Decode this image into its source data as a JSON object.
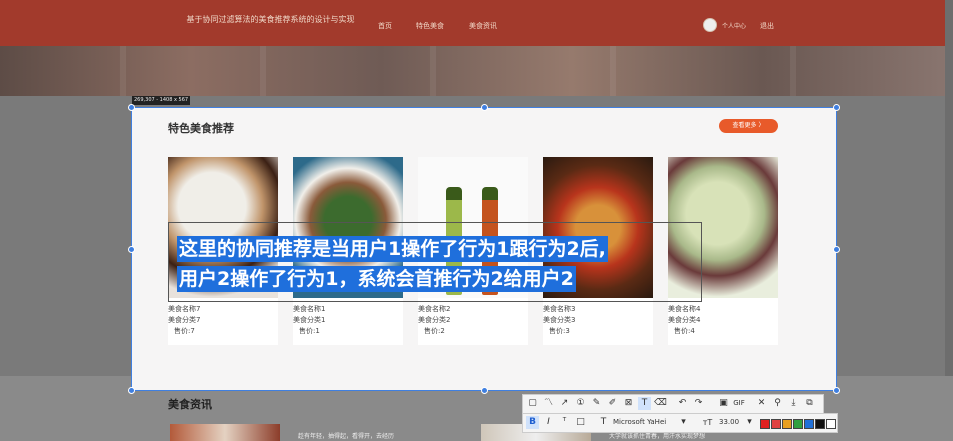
{
  "site": {
    "title": "基于协同过滤算法的美食推荐系统的设计与实现"
  },
  "nav": {
    "home": "首页",
    "special": "特色美食",
    "news": "美食资讯",
    "user_center": "个人中心",
    "logout": "退出"
  },
  "capture": {
    "size_label": "269,307 - 1408 x 567"
  },
  "section": {
    "title": "特色美食推荐",
    "more_label": "查看更多 〉"
  },
  "cards": [
    {
      "name": "美食名称7",
      "category": "美食分类7",
      "price": "售价:7"
    },
    {
      "name": "美食名称1",
      "category": "美食分类1",
      "price": "售价:1"
    },
    {
      "name": "美食名称2",
      "category": "美食分类2",
      "price": "售价:2"
    },
    {
      "name": "美食名称3",
      "category": "美食分类3",
      "price": "售价:3"
    },
    {
      "name": "美食名称4",
      "category": "美食分类4",
      "price": "售价:4"
    }
  ],
  "caption": {
    "line1": "这里的协同推荐是当用户1操作了行为1跟行为2后,",
    "line2": "用户2操作了行为1，系统会首推行为2给用户2"
  },
  "news": {
    "title": "美食资讯",
    "item1": "趁有年轻，抽得起，看得开，去经历",
    "item2": "大学就该抓住青春，用汗水实现梦想"
  },
  "toolbar": {
    "gif": "GIF",
    "font_name": "Microsoft YaHei",
    "font_size": "33.00",
    "bold": "B",
    "italic": "I"
  },
  "colors": {
    "brand": "#a23a2c",
    "accent": "#e85a2a",
    "selection": "#3f7fe0",
    "caption_bg": "#1f6fdc"
  }
}
